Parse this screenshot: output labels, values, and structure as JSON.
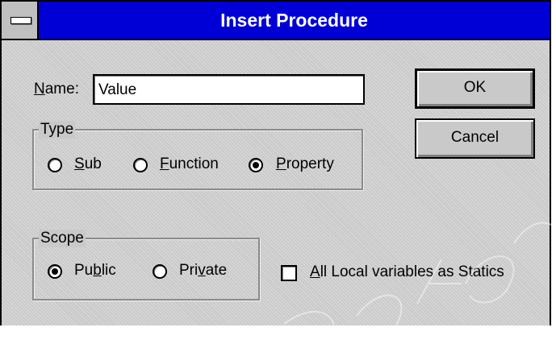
{
  "dialog": {
    "title": "Insert Procedure",
    "name_label": "Name:",
    "name_value": "Value",
    "ok_label": "OK",
    "cancel_label": "Cancel",
    "type_group": {
      "label": "Type",
      "options": [
        "Sub",
        "Function",
        "Property"
      ],
      "selected": "Property"
    },
    "scope_group": {
      "label": "Scope",
      "options": [
        "Public",
        "Private"
      ],
      "selected": "Public"
    },
    "statics_label": "All Local variables as Statics",
    "statics_checked": false
  }
}
